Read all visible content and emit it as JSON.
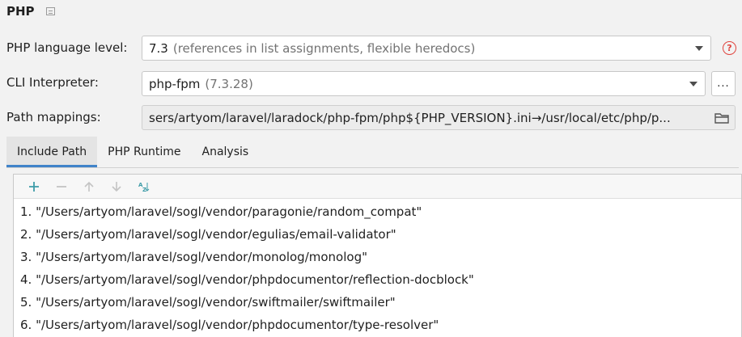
{
  "header": {
    "title": "PHP"
  },
  "language_level": {
    "label": "PHP language level:",
    "value": "7.3",
    "hint": "(references in list assignments, flexible heredocs)"
  },
  "cli": {
    "label": "CLI Interpreter:",
    "value": "php-fpm",
    "hint": "(7.3.28)",
    "more_button": "..."
  },
  "path_mappings": {
    "label": "Path mappings:",
    "value": "sers/artyom/laravel/laradock/php-fpm/php${PHP_VERSION}.ini→/usr/local/etc/php/p..."
  },
  "tabs": [
    {
      "label": "Include Path",
      "active": true
    },
    {
      "label": "PHP Runtime",
      "active": false
    },
    {
      "label": "Analysis",
      "active": false
    }
  ],
  "toolbar": {
    "icons": [
      "add-icon",
      "remove-icon",
      "move-up-icon",
      "move-down-icon",
      "sort-az-icon"
    ],
    "accent": "#3e9ca8"
  },
  "include_paths": [
    "1. \"/Users/artyom/laravel/sogl/vendor/paragonie/random_compat\"",
    "2. \"/Users/artyom/laravel/sogl/vendor/egulias/email-validator\"",
    "3. \"/Users/artyom/laravel/sogl/vendor/monolog/monolog\"",
    "4. \"/Users/artyom/laravel/sogl/vendor/phpdocumentor/reflection-docblock\"",
    "5. \"/Users/artyom/laravel/sogl/vendor/swiftmailer/swiftmailer\"",
    "6. \"/Users/artyom/laravel/sogl/vendor/phpdocumentor/type-resolver\""
  ],
  "colors": {
    "help": "#e0443e",
    "tab_underline": "#4083c9"
  }
}
